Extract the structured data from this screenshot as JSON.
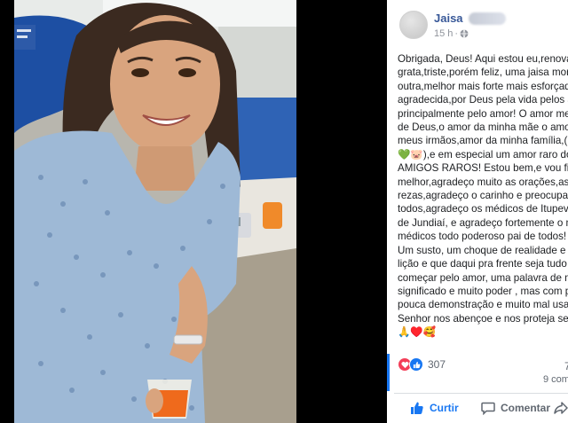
{
  "post": {
    "author": "Jaisa",
    "time": "15 h",
    "separator": "·",
    "lines": [
      "Obrigada, Deus! Aqui estou eu,renovad",
      "grata,triste,porém feliz, uma jaisa morre",
      "outra,melhor mais forte mais esforçada",
      "agradecida,por Deus pela vida pelos an",
      "principalmente pelo amor! O amor me s",
      "de Deus,o amor da minha mãe o amor",
      "meus irmãos,amor da minha família,(un",
      "💚🐷),e em especial um amor raro dos",
      "AMIGOS RAROS! Estou bem,e vou fica",
      "melhor,agradeço muito as orações,as",
      "rezas,agradeço o carinho e preocupaç",
      "todos,agradeço os médicos de Itupeva",
      "de Jundiaí, e agradeço fortemente o m",
      "médicos todo poderoso pai de todos!",
      "Um susto, um choque de realidade e u",
      "lição e que daqui pra frente seja tudo d",
      "começar pelo amor, uma palavra de mu",
      "significado e muito poder , mas com po",
      "pouca demonstração e muito mal usad",
      "Senhor nos abençoe e nos proteja sem",
      "🙏♥️🥰"
    ]
  },
  "stats": {
    "reactions_count": "307",
    "right_stat": "7",
    "comments": "9 com"
  },
  "actions": {
    "like": "Curtir",
    "comment": "Comentar"
  },
  "icons": {
    "privacy": "globe-icon",
    "like": "thumbs-up-icon",
    "comment": "comment-bubble-icon",
    "share": "share-arrow-icon",
    "love_reaction": "heart-icon",
    "like_reaction": "like-icon"
  },
  "colors": {
    "author": "#385898",
    "brand_blue": "#1877f2",
    "love": "#f33e58",
    "secondary_text": "#606770"
  }
}
